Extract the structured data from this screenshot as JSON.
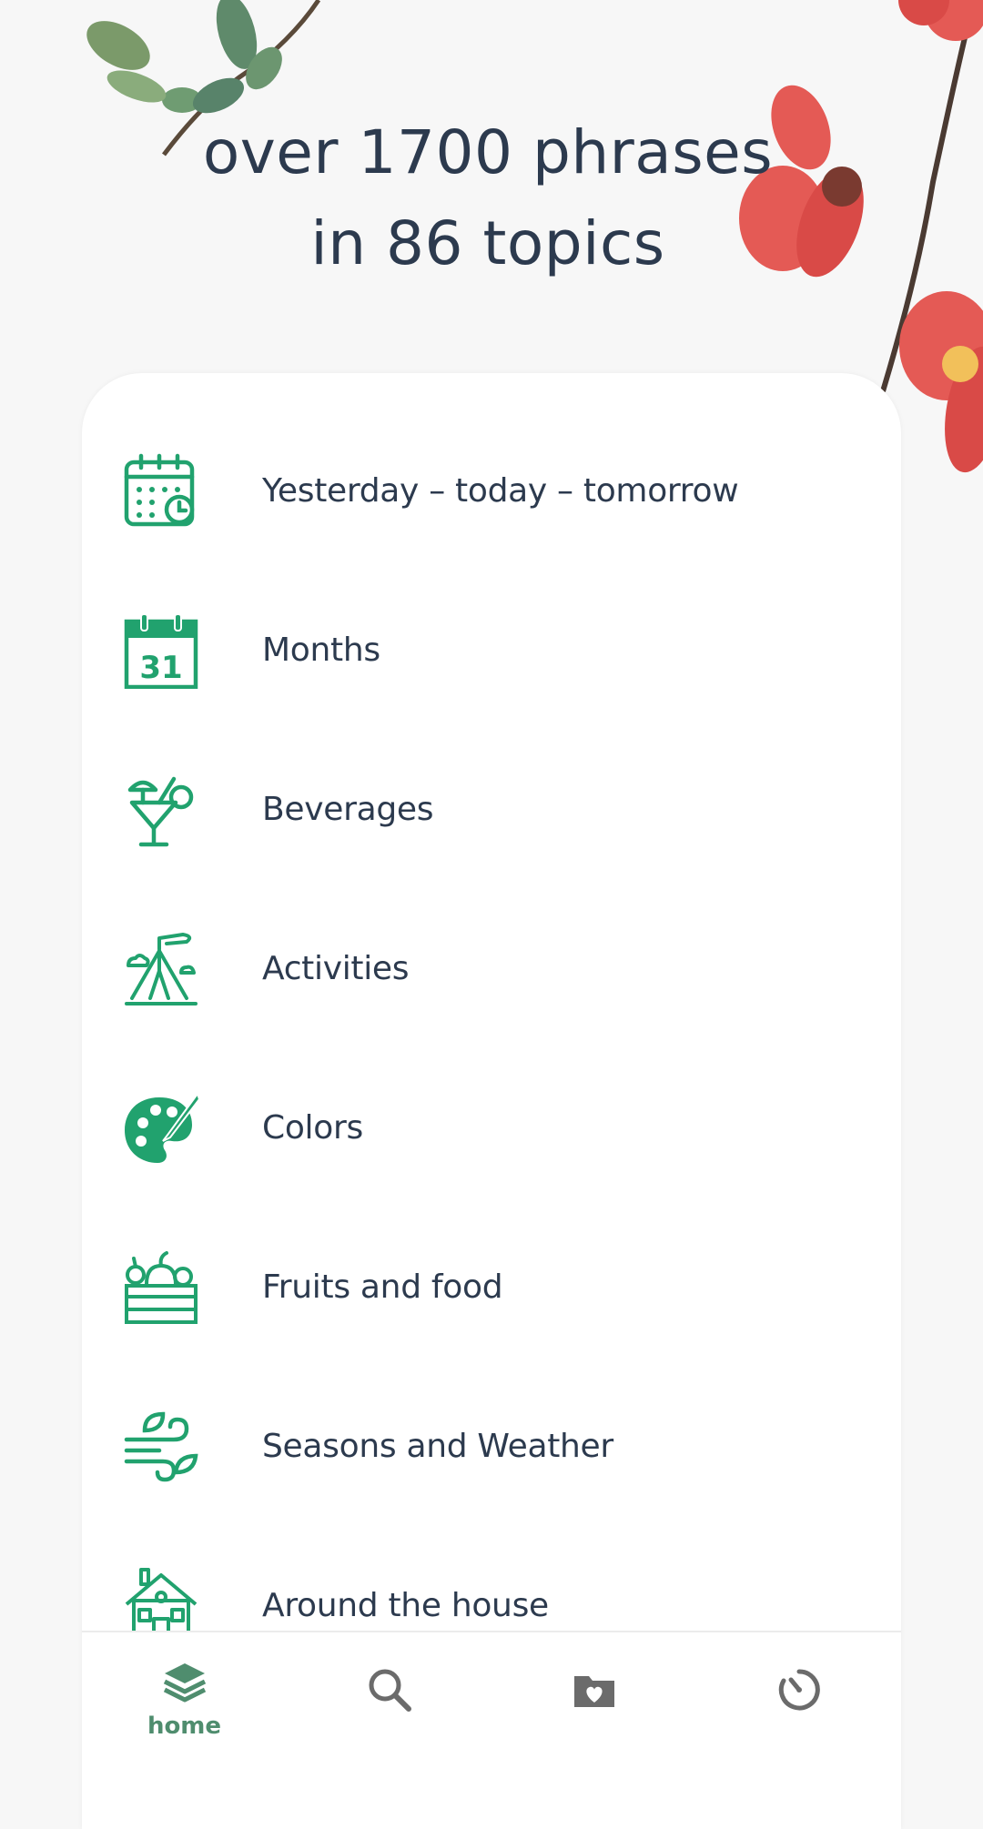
{
  "headline": {
    "line1": "over 1700 phrases",
    "line2": "in 86 topics"
  },
  "colors": {
    "accent": "#21a26e",
    "text": "#2c3a4e",
    "nav_active": "#4f8d6e",
    "nav_inactive": "#6b6b6b",
    "blossom": "#e45a55"
  },
  "topics": [
    {
      "label": "Yesterday – today – tomorrow",
      "icon": "calendar-clock-icon"
    },
    {
      "label": "Months",
      "icon": "calendar-31-icon"
    },
    {
      "label": "Beverages",
      "icon": "cocktail-icon"
    },
    {
      "label": "Activities",
      "icon": "tent-icon"
    },
    {
      "label": "Colors",
      "icon": "palette-icon"
    },
    {
      "label": "Fruits and food",
      "icon": "food-crate-icon"
    },
    {
      "label": "Seasons and Weather",
      "icon": "wind-leaves-icon"
    },
    {
      "label": "Around the house",
      "icon": "house-icon"
    }
  ],
  "bottom_nav": {
    "home": {
      "label": "home",
      "icon": "layers-icon",
      "active": true
    },
    "search": {
      "icon": "search-icon"
    },
    "favorites": {
      "icon": "heart-folder-icon"
    },
    "history": {
      "icon": "timer-icon"
    }
  }
}
